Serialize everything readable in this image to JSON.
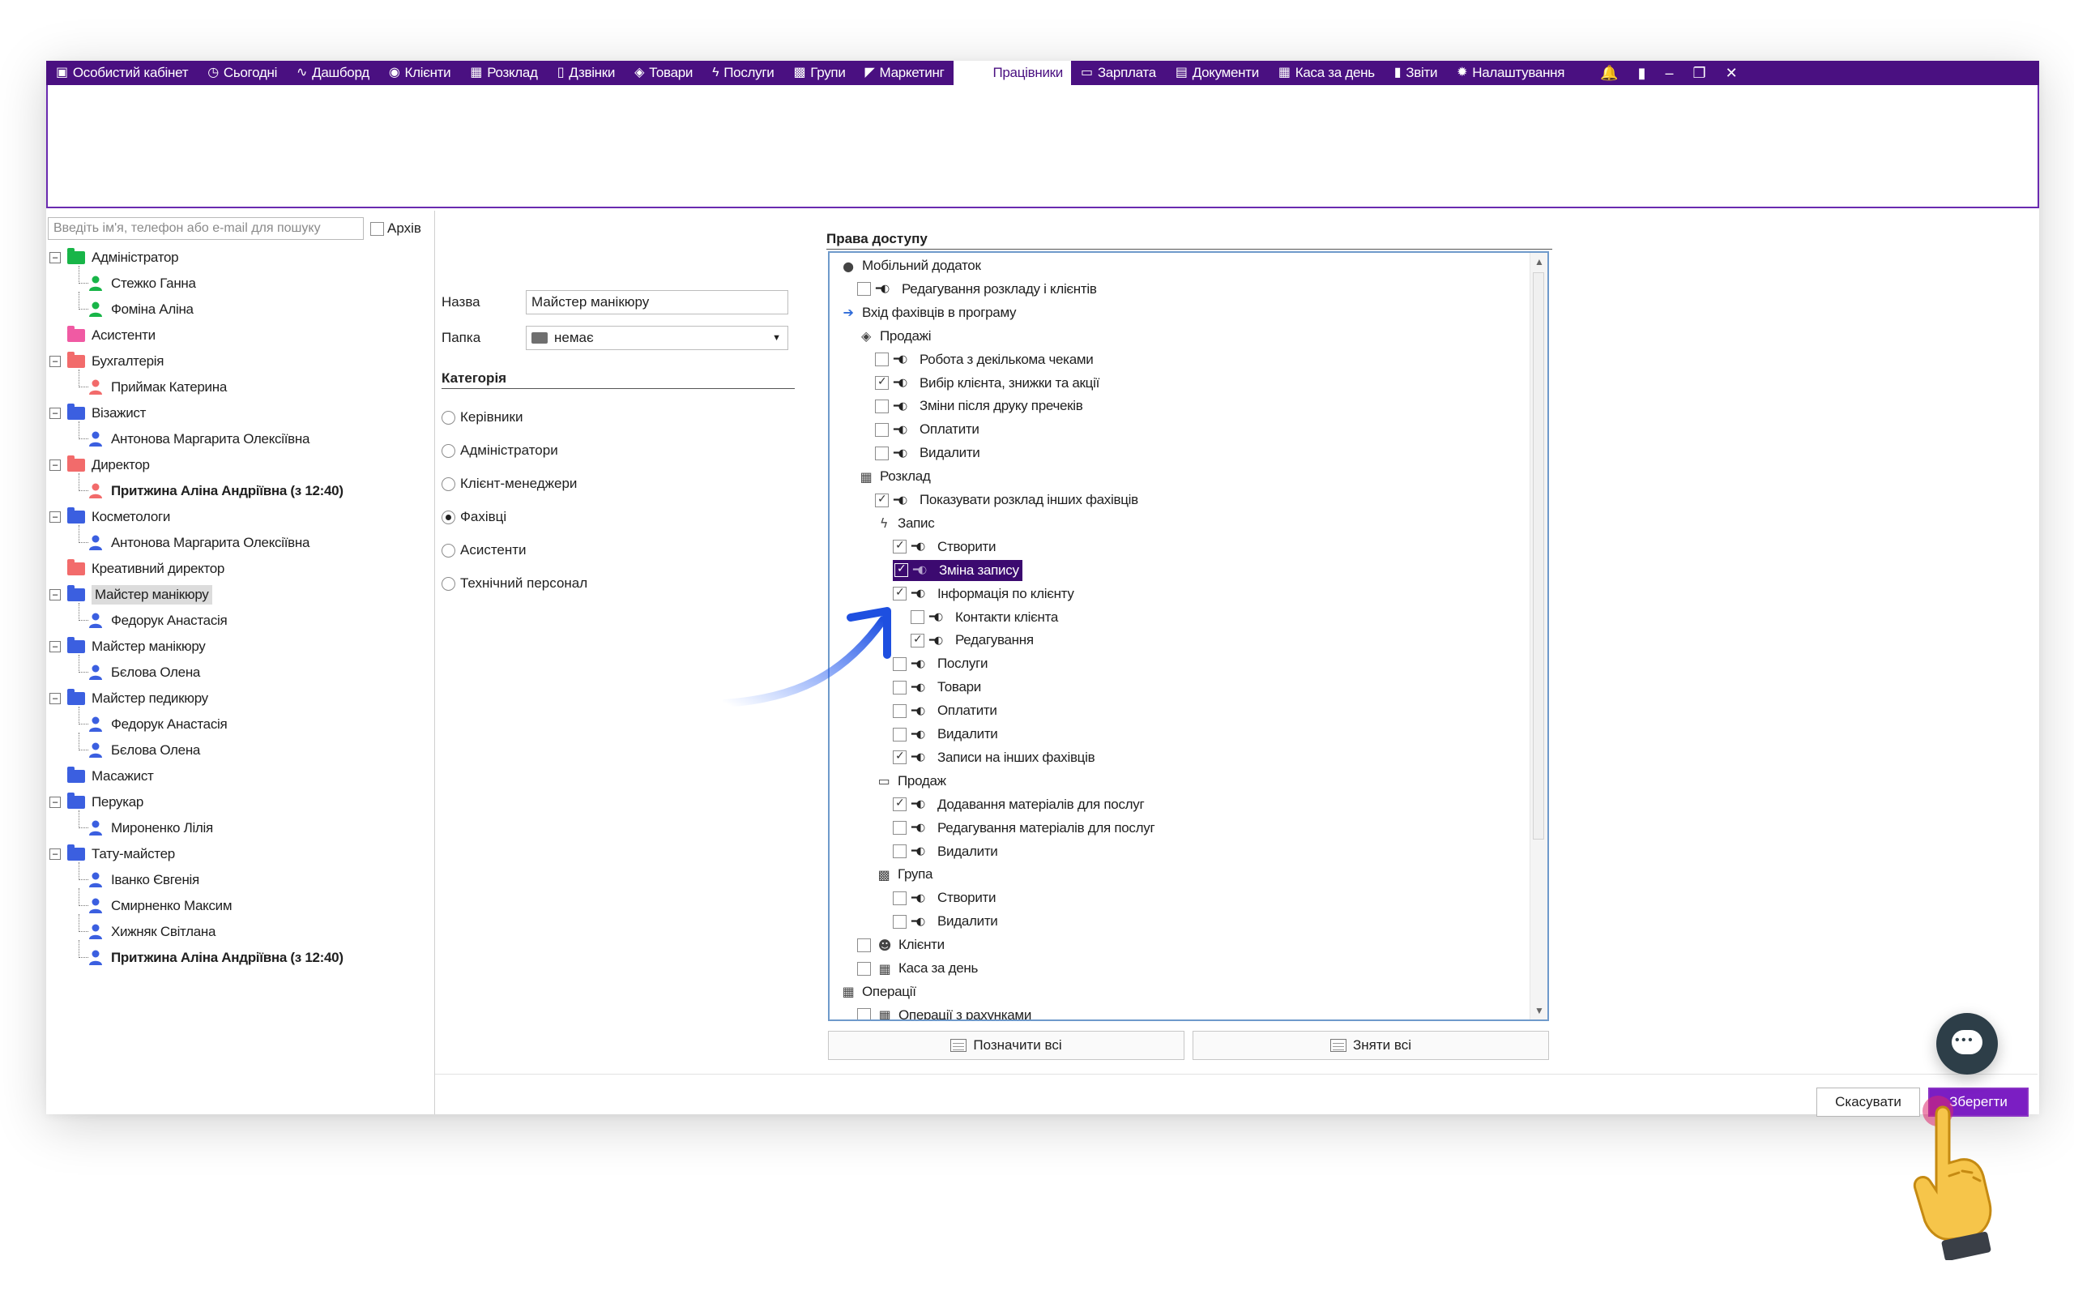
{
  "colors": {
    "brand": "#4a1081",
    "highlight": "#3c0a70",
    "save": "#7b1ec3",
    "tree_border": "#6f9acb"
  },
  "menu": {
    "left": [
      {
        "icon": "briefcase-icon",
        "label": "Особистий кабінет"
      },
      {
        "icon": "clock-icon",
        "label": "Сьогодні"
      },
      {
        "icon": "pulse-icon",
        "label": "Дашборд"
      },
      {
        "icon": "user-circle-icon",
        "label": "Клієнти"
      },
      {
        "icon": "calendar-icon",
        "label": "Розклад"
      },
      {
        "icon": "phone-icon",
        "label": "Дзвінки"
      },
      {
        "icon": "box-icon",
        "label": "Товари"
      },
      {
        "icon": "lightning-icon",
        "label": "Послуги"
      },
      {
        "icon": "group-icon",
        "label": "Групи"
      },
      {
        "icon": "megaphone-icon",
        "label": "Маркетинг"
      }
    ],
    "active": "Працівники",
    "right": [
      {
        "icon": "money-icon",
        "label": "Зарплата"
      },
      {
        "icon": "document-icon",
        "label": "Документи"
      },
      {
        "icon": "calculator-icon",
        "label": "Каса за день"
      },
      {
        "icon": "bar-chart-icon",
        "label": "Звіти"
      },
      {
        "icon": "gear-icon",
        "label": "Налаштування"
      }
    ]
  },
  "search": {
    "placeholder": "Введіть ім'я, телефон або e-mail для пошуку",
    "archive_label": "Архів"
  },
  "tree": [
    {
      "type": "group",
      "label": "Адміністратор",
      "color": "#18b548",
      "expandable": true
    },
    {
      "type": "person",
      "label": "Стежко Ганна",
      "color": "#18b548"
    },
    {
      "type": "person",
      "label": "Фоміна Аліна",
      "color": "#18b548"
    },
    {
      "type": "group",
      "label": "Асистенти",
      "color": "#f05aa3",
      "expandable": false
    },
    {
      "type": "group",
      "label": "Бухгалтерія",
      "color": "#f26b6b",
      "expandable": true
    },
    {
      "type": "person",
      "label": "Приймак Катерина",
      "color": "#f26b6b"
    },
    {
      "type": "group",
      "label": "Візажист",
      "color": "#3b5fe0",
      "expandable": true
    },
    {
      "type": "person",
      "label": "Антонова Маргарита Олексіївна",
      "color": "#3b5fe0"
    },
    {
      "type": "group",
      "label": "Директор",
      "color": "#f26b6b",
      "expandable": true
    },
    {
      "type": "person",
      "label": "Притжина Аліна Андріївна (з 12:40)",
      "color": "#f26b6b",
      "bold": true
    },
    {
      "type": "group",
      "label": "Косметологи",
      "color": "#3b5fe0",
      "expandable": true
    },
    {
      "type": "person",
      "label": "Антонова Маргарита Олексіївна",
      "color": "#3b5fe0"
    },
    {
      "type": "group",
      "label": "Креативний директор",
      "color": "#f26b6b",
      "expandable": false
    },
    {
      "type": "group",
      "label": "Майстер манікюру",
      "color": "#3b5fe0",
      "expandable": true,
      "selected": true
    },
    {
      "type": "person",
      "label": "Федорук Анастасія",
      "color": "#3b5fe0"
    },
    {
      "type": "group",
      "label": "Майстер манікюру",
      "color": "#3b5fe0",
      "expandable": true
    },
    {
      "type": "person",
      "label": "Бєлова Олена",
      "color": "#3b5fe0"
    },
    {
      "type": "group",
      "label": "Майстер педикюру",
      "color": "#3b5fe0",
      "expandable": true
    },
    {
      "type": "person",
      "label": "Федорук Анастасія",
      "color": "#3b5fe0"
    },
    {
      "type": "person",
      "label": "Бєлова Олена",
      "color": "#3b5fe0"
    },
    {
      "type": "group",
      "label": "Масажист",
      "color": "#3b5fe0",
      "expandable": false
    },
    {
      "type": "group",
      "label": "Перукар",
      "color": "#3b5fe0",
      "expandable": true
    },
    {
      "type": "person",
      "label": "Мироненко Лілія",
      "color": "#3b5fe0"
    },
    {
      "type": "group",
      "label": "Тату-майстер",
      "color": "#3b5fe0",
      "expandable": true
    },
    {
      "type": "person",
      "label": "Іванко Євгенія",
      "color": "#3b5fe0"
    },
    {
      "type": "person",
      "label": "Смирненко Максим",
      "color": "#3b5fe0"
    },
    {
      "type": "person",
      "label": "Хижняк Світлана",
      "color": "#3b5fe0"
    },
    {
      "type": "person",
      "label": "Притжина Аліна Андріївна (з 12:40)",
      "color": "#3b5fe0",
      "bold": true
    }
  ],
  "form": {
    "name_label": "Назва",
    "name_value": "Майстер манікюру",
    "folder_label": "Папка",
    "folder_value": "немає",
    "category_title": "Категорія",
    "categories": [
      {
        "label": "Керівники",
        "selected": false
      },
      {
        "label": "Адміністратори",
        "selected": false
      },
      {
        "label": "Клієнт-менеджери",
        "selected": false
      },
      {
        "label": "Фахівці",
        "selected": true
      },
      {
        "label": "Асистенти",
        "selected": false
      },
      {
        "label": "Технічний персонал",
        "selected": false
      }
    ]
  },
  "rights": {
    "title": "Права доступу",
    "items": [
      {
        "level": 0,
        "kind": "node",
        "icon": "speech-bubble-icon",
        "label": "Мобільний додаток"
      },
      {
        "level": 1,
        "kind": "perm",
        "checked": false,
        "label": "Редагування розкладу і клієнтів"
      },
      {
        "level": 0,
        "kind": "node",
        "icon": "arrow-right-icon",
        "label": "Вхід фахівців в програму"
      },
      {
        "level": 1,
        "kind": "node",
        "icon": "box-icon",
        "label": "Продажі"
      },
      {
        "level": 2,
        "kind": "perm",
        "checked": false,
        "label": "Робота з декількома чеками"
      },
      {
        "level": 2,
        "kind": "perm",
        "checked": true,
        "label": "Вибір клієнта, знижки та акції"
      },
      {
        "level": 2,
        "kind": "perm",
        "checked": false,
        "label": "Зміни після друку пречеків"
      },
      {
        "level": 2,
        "kind": "perm",
        "checked": false,
        "label": "Оплатити"
      },
      {
        "level": 2,
        "kind": "perm",
        "checked": false,
        "label": "Видалити"
      },
      {
        "level": 1,
        "kind": "node",
        "icon": "calendar-icon",
        "label": "Розклад"
      },
      {
        "level": 2,
        "kind": "perm",
        "checked": true,
        "label": "Показувати розклад інших фахівців"
      },
      {
        "level": 2,
        "kind": "node",
        "icon": "lightning-icon",
        "label": "Запис"
      },
      {
        "level": 3,
        "kind": "perm",
        "checked": true,
        "label": "Створити"
      },
      {
        "level": 3,
        "kind": "perm",
        "checked": true,
        "label": "Зміна запису",
        "highlight": true
      },
      {
        "level": 3,
        "kind": "perm",
        "checked": true,
        "label": "Інформація по клієнту"
      },
      {
        "level": 4,
        "kind": "perm",
        "checked": false,
        "label": "Контакти клієнта"
      },
      {
        "level": 4,
        "kind": "perm",
        "checked": true,
        "label": "Редагування"
      },
      {
        "level": 3,
        "kind": "perm",
        "checked": false,
        "label": "Послуги"
      },
      {
        "level": 3,
        "kind": "perm",
        "checked": false,
        "label": "Товари"
      },
      {
        "level": 3,
        "kind": "perm",
        "checked": false,
        "label": "Оплатити"
      },
      {
        "level": 3,
        "kind": "perm",
        "checked": false,
        "label": "Видалити"
      },
      {
        "level": 3,
        "kind": "perm",
        "checked": true,
        "label": "Записи на інших фахівців"
      },
      {
        "level": 2,
        "kind": "node",
        "icon": "money-icon",
        "label": "Продаж"
      },
      {
        "level": 3,
        "kind": "perm",
        "checked": true,
        "label": "Додавання матеріалів для послуг"
      },
      {
        "level": 3,
        "kind": "perm",
        "checked": false,
        "label": "Редагування матеріалів для послуг"
      },
      {
        "level": 3,
        "kind": "perm",
        "checked": false,
        "label": "Видалити"
      },
      {
        "level": 2,
        "kind": "node",
        "icon": "group-icon",
        "label": "Група"
      },
      {
        "level": 3,
        "kind": "perm",
        "checked": false,
        "label": "Створити"
      },
      {
        "level": 3,
        "kind": "perm",
        "checked": false,
        "label": "Видалити"
      },
      {
        "level": 1,
        "kind": "permnode",
        "checked": false,
        "icon": "clients-icon",
        "label": "Клієнти"
      },
      {
        "level": 1,
        "kind": "permnode",
        "checked": false,
        "icon": "calculator-icon",
        "label": "Каса за день"
      },
      {
        "level": 0,
        "kind": "node",
        "icon": "calculator-icon",
        "label": "Операції"
      },
      {
        "level": 1,
        "kind": "permnode",
        "checked": false,
        "icon": "calculator-icon",
        "label": "Операції з рахунками"
      }
    ],
    "select_all": "Позначити всі",
    "deselect_all": "Зняти всі"
  },
  "footer": {
    "cancel": "Скасувати",
    "save": "Зберегти"
  }
}
